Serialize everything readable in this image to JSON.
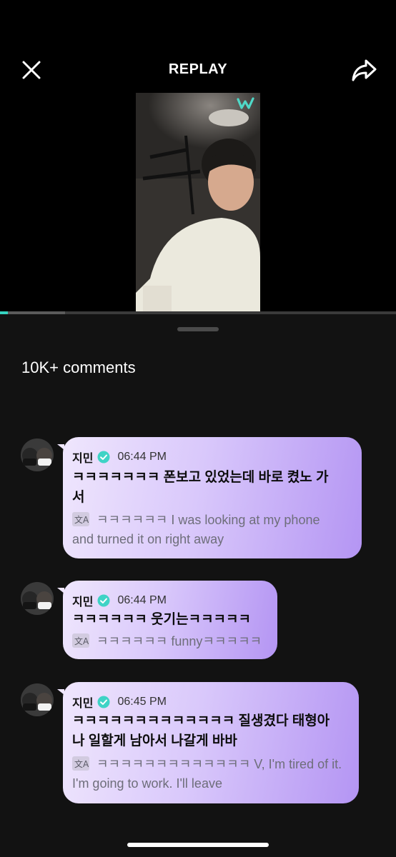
{
  "header": {
    "title": "REPLAY"
  },
  "video": {
    "progress": 0.02,
    "buffered": 0.165,
    "watermark_icon": "w-logo-icon"
  },
  "comments_count": "10K+ comments",
  "comments": [
    {
      "name": "지민",
      "time": "06:44 PM",
      "text_line1": "ㅋㅋㅋㅋㅋㅋㅋ 폰보고 있었는데 바로 켰노 가",
      "text_line2": "서",
      "translation_line1": "ㅋㅋㅋㅋㅋㅋ I was looking at my phone",
      "translation_line2": "and turned it on right away"
    },
    {
      "name": "지민",
      "time": "06:44 PM",
      "text_line1": "ㅋㅋㅋㅋㅋㅋ 웃기는ㅋㅋㅋㅋㅋ",
      "translation_line1": "ㅋㅋㅋㅋㅋㅋ funnyㅋㅋㅋㅋㅋ"
    },
    {
      "name": "지민",
      "time": "06:45 PM",
      "text_line1": "ㅋㅋㅋㅋㅋㅋㅋㅋㅋㅋㅋㅋㅋ 질생겼다 태형아",
      "text_line2": "나 일할게 남아서 나갈게 바바",
      "translation_line1": "ㅋㅋㅋㅋㅋㅋㅋㅋㅋㅋㅋㅋㅋ V, I'm tired of it.",
      "translation_line2": "I'm going to work. I'll leave"
    }
  ],
  "colors": {
    "accent": "#36d3c0",
    "bubble_start": "#efe6fd",
    "bubble_end": "#b495f3",
    "verified": "#3fd3c6"
  }
}
